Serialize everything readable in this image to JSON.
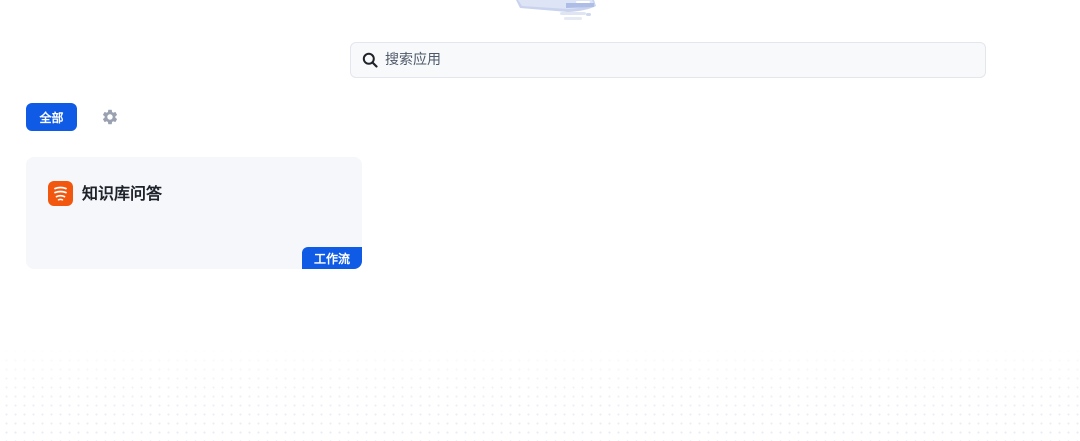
{
  "header": {
    "illustration_icon": "monitor-illustration-icon"
  },
  "search": {
    "icon": "search-icon",
    "placeholder": "搜索应用",
    "value": ""
  },
  "filters": {
    "all_label": "全部",
    "settings_icon": "gear-icon"
  },
  "apps": [
    {
      "title": "知识库问答",
      "icon": "knowledge-base-icon",
      "type_badge": "工作流"
    }
  ],
  "colors": {
    "accent": "#0f5be6",
    "app_icon_bg": "#f2570f",
    "card_bg": "#f6f7fa",
    "search_bg": "#f8f9fb"
  }
}
